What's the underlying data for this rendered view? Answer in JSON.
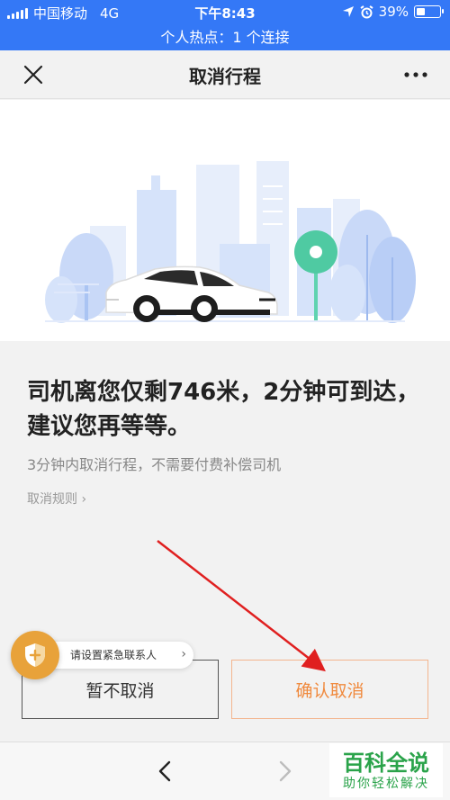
{
  "status_bar": {
    "carrier": "中国移动",
    "network": "4G",
    "time": "下午8:43",
    "battery": "39%",
    "battery_level": 0.39,
    "hotspot": "个人热点：1 个连接"
  },
  "nav": {
    "title": "取消行程",
    "close_icon": "close-icon",
    "more_icon": "more-icon"
  },
  "main": {
    "headline": "司机离您仅剩746米，2分钟可到达，建议您再等等。",
    "subtext": "3分钟内取消行程，不需要付费补偿司机",
    "rules_link": "取消规则 ›"
  },
  "buttons": {
    "keep": "暂不取消",
    "confirm": "确认取消"
  },
  "emergency": {
    "label": "请设置紧急联系人",
    "chevron": "›",
    "icon": "shield-plus-icon"
  },
  "bottom_nav": {
    "back_icon": "chevron-left-icon",
    "forward_icon": "chevron-right-icon"
  },
  "watermark": {
    "title": "百科全说",
    "subtitle": "助你轻松解决"
  },
  "colors": {
    "status_bar": "#3478f6",
    "accent_orange": "#f08a3e",
    "shield": "#e8a23a",
    "annotation_arrow": "#e02020",
    "watermark_green": "#2aa34a"
  }
}
